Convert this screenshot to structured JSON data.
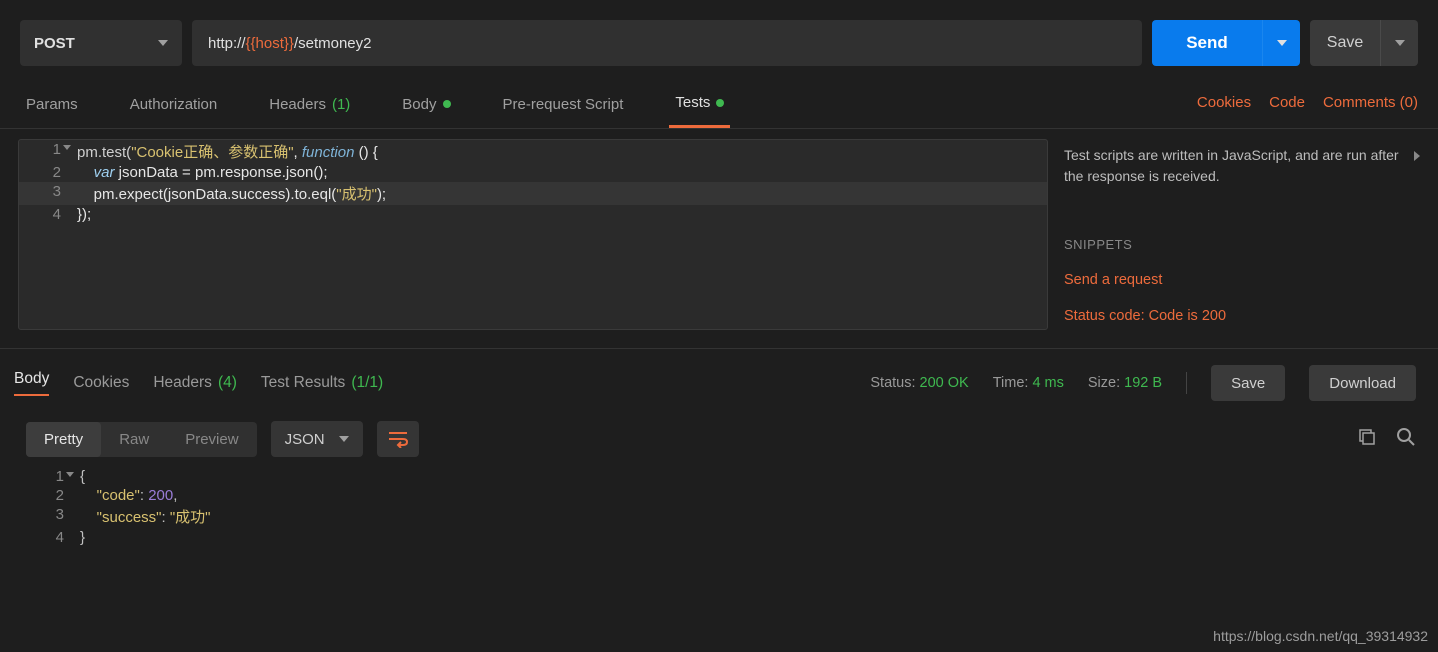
{
  "request": {
    "method": "POST",
    "url_prefix": "http://",
    "url_var": "{{host}}",
    "url_suffix": "/setmoney2",
    "send_label": "Send",
    "save_label": "Save"
  },
  "req_tabs": {
    "params": "Params",
    "auth": "Authorization",
    "headers": "Headers",
    "headers_count": "(1)",
    "body": "Body",
    "prescript": "Pre-request Script",
    "tests": "Tests"
  },
  "req_links": {
    "cookies": "Cookies",
    "code": "Code",
    "comments": "Comments (0)"
  },
  "editor": {
    "l1_a": "pm.test(",
    "l1_b": "\"Cookie正确、参数正确\"",
    "l1_c": ", ",
    "l1_d": "function",
    "l1_e": " () {",
    "l2_a": "    ",
    "l2_b": "var",
    "l2_c": " jsonData = pm.response.json();",
    "l3_a": "    pm.expect(jsonData.success).to.eql(",
    "l3_b": "\"成功\"",
    "l3_c": ");",
    "l4": "});"
  },
  "side": {
    "desc": "Test scripts are written in JavaScript, and are run after the response is received.",
    "snippets_title": "SNIPPETS",
    "snip1": "Send a request",
    "snip2": "Status code: Code is 200"
  },
  "resp_tabs": {
    "body": "Body",
    "cookies": "Cookies",
    "headers": "Headers",
    "headers_count": "(4)",
    "testres": "Test Results",
    "testres_count": "(1/1)"
  },
  "resp_stats": {
    "status_lbl": "Status:",
    "status_val": "200 OK",
    "time_lbl": "Time:",
    "time_val": "4 ms",
    "size_lbl": "Size:",
    "size_val": "192 B",
    "save": "Save",
    "download": "Download"
  },
  "format": {
    "pretty": "Pretty",
    "raw": "Raw",
    "preview": "Preview",
    "json": "JSON"
  },
  "resp_body": {
    "l1": "{",
    "l2_k": "\"code\"",
    "l2_v": "200",
    "l3_k": "\"success\"",
    "l3_v": "\"成功\"",
    "l4": "}"
  },
  "watermark": "https://blog.csdn.net/qq_39314932"
}
